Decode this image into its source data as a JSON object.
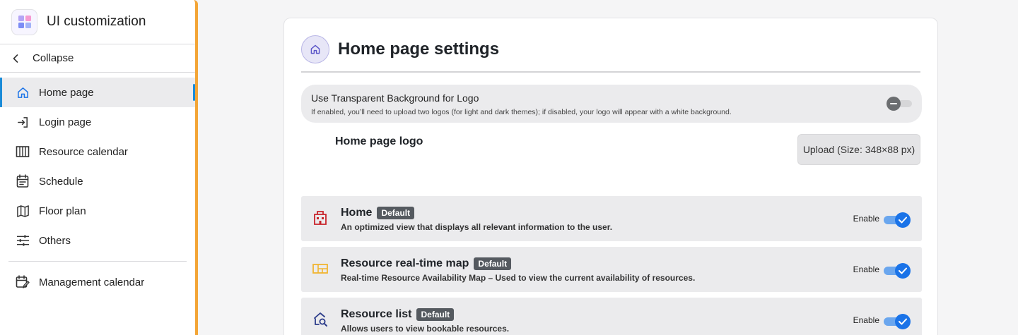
{
  "sidebar": {
    "app_title": "UI customization",
    "collapse_label": "Collapse",
    "items": [
      {
        "label": "Home page",
        "icon": "home-icon",
        "active": true
      },
      {
        "label": "Login page",
        "icon": "login-icon"
      },
      {
        "label": "Resource calendar",
        "icon": "calendar-columns-icon"
      },
      {
        "label": "Schedule",
        "icon": "schedule-icon"
      },
      {
        "label": "Floor plan",
        "icon": "map-icon"
      },
      {
        "label": "Others",
        "icon": "sliders-icon"
      }
    ],
    "bottom_items": [
      {
        "label": "Management calendar",
        "icon": "calendar-edit-icon"
      }
    ]
  },
  "main": {
    "title": "Home page settings",
    "transparent_bg": {
      "title": "Use Transparent Background for Logo",
      "description": "If enabled, you’ll need to upload two logos (for light and dark themes); if disabled, your logo will appear with a white background.",
      "enabled": false
    },
    "logo": {
      "label": "Home page logo",
      "upload_label": "Upload (Size: 348×88 px)"
    },
    "modules": [
      {
        "name": "Home",
        "badge": "Default",
        "description": "An optimized view that displays all relevant information to the user.",
        "enable_label": "Enable",
        "enabled": true,
        "icon": "building-icon",
        "icon_color": "#c8242b"
      },
      {
        "name": "Resource real-time map",
        "badge": "Default",
        "description": "Real-time Resource Availability Map – Used to view the current availability of resources.",
        "enable_label": "Enable",
        "enabled": true,
        "icon": "floor-map-icon",
        "icon_color": "#f1b531"
      },
      {
        "name": "Resource list",
        "badge": "Default",
        "description": "Allows users to view bookable resources.",
        "enable_label": "Enable",
        "enabled": true,
        "icon": "search-list-icon",
        "icon_color": "#2c3c8a"
      }
    ]
  },
  "colors": {
    "accent": "#1a8bd8",
    "sidebar_border": "#f3a536",
    "toggle_on": "#1a73e8"
  }
}
